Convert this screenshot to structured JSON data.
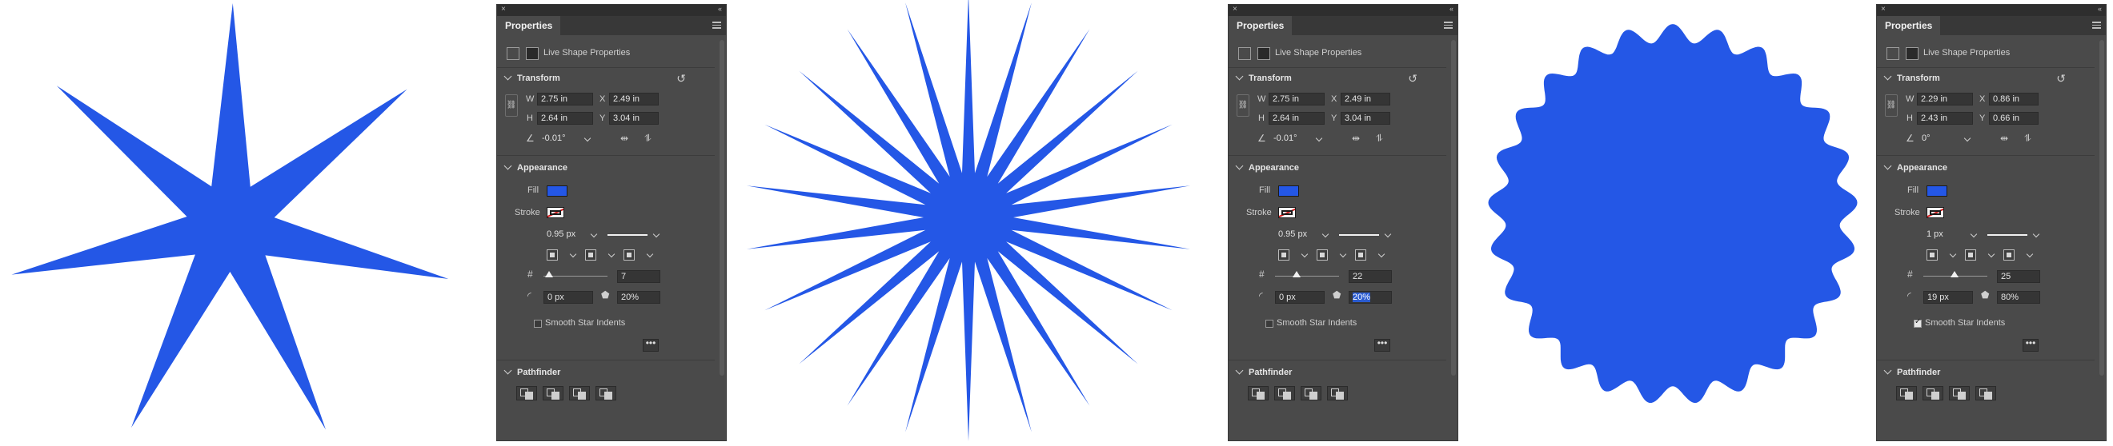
{
  "colors": {
    "shape_fill": "#2457e6",
    "panel_bg": "#4a4a4a",
    "fill_swatch": "#2457e6"
  },
  "panels": [
    {
      "tab": "Properties",
      "live_shape_label": "Live Shape Properties",
      "transform_title": "Transform",
      "w_label": "W",
      "w_value": "2.75 in",
      "x_label": "X",
      "x_value": "2.49 in",
      "h_label": "H",
      "h_value": "2.64 in",
      "y_label": "Y",
      "y_value": "3.04 in",
      "angle": "-0.01°",
      "appearance_title": "Appearance",
      "fill_label": "Fill",
      "stroke_label": "Stroke",
      "stroke_width": "0.95 px",
      "points": "7",
      "corner_radius": "0 px",
      "star_ratio": "20%",
      "smooth_label": "Smooth Star Indents",
      "smooth_checked": false,
      "more": "•••",
      "pathfinder_title": "Pathfinder"
    },
    {
      "tab": "Properties",
      "live_shape_label": "Live Shape Properties",
      "transform_title": "Transform",
      "w_label": "W",
      "w_value": "2.75 in",
      "x_label": "X",
      "x_value": "2.49 in",
      "h_label": "H",
      "h_value": "2.64 in",
      "y_label": "Y",
      "y_value": "3.04 in",
      "angle": "-0.01°",
      "appearance_title": "Appearance",
      "fill_label": "Fill",
      "stroke_label": "Stroke",
      "stroke_width": "0.95 px",
      "points": "22",
      "corner_radius": "0 px",
      "star_ratio": "20%",
      "smooth_label": "Smooth Star Indents",
      "smooth_checked": false,
      "more": "•••",
      "pathfinder_title": "Pathfinder"
    },
    {
      "tab": "Properties",
      "live_shape_label": "Live Shape Properties",
      "transform_title": "Transform",
      "w_label": "W",
      "w_value": "2.29 in",
      "x_label": "X",
      "x_value": "0.86 in",
      "h_label": "H",
      "h_value": "2.43 in",
      "y_label": "Y",
      "y_value": "0.66 in",
      "angle": "0°",
      "appearance_title": "Appearance",
      "fill_label": "Fill",
      "stroke_label": "Stroke",
      "stroke_width": "1 px",
      "points": "25",
      "corner_radius": "19 px",
      "star_ratio": "80%",
      "smooth_label": "Smooth Star Indents",
      "smooth_checked": true,
      "more": "•••",
      "pathfinder_title": "Pathfinder"
    }
  ]
}
